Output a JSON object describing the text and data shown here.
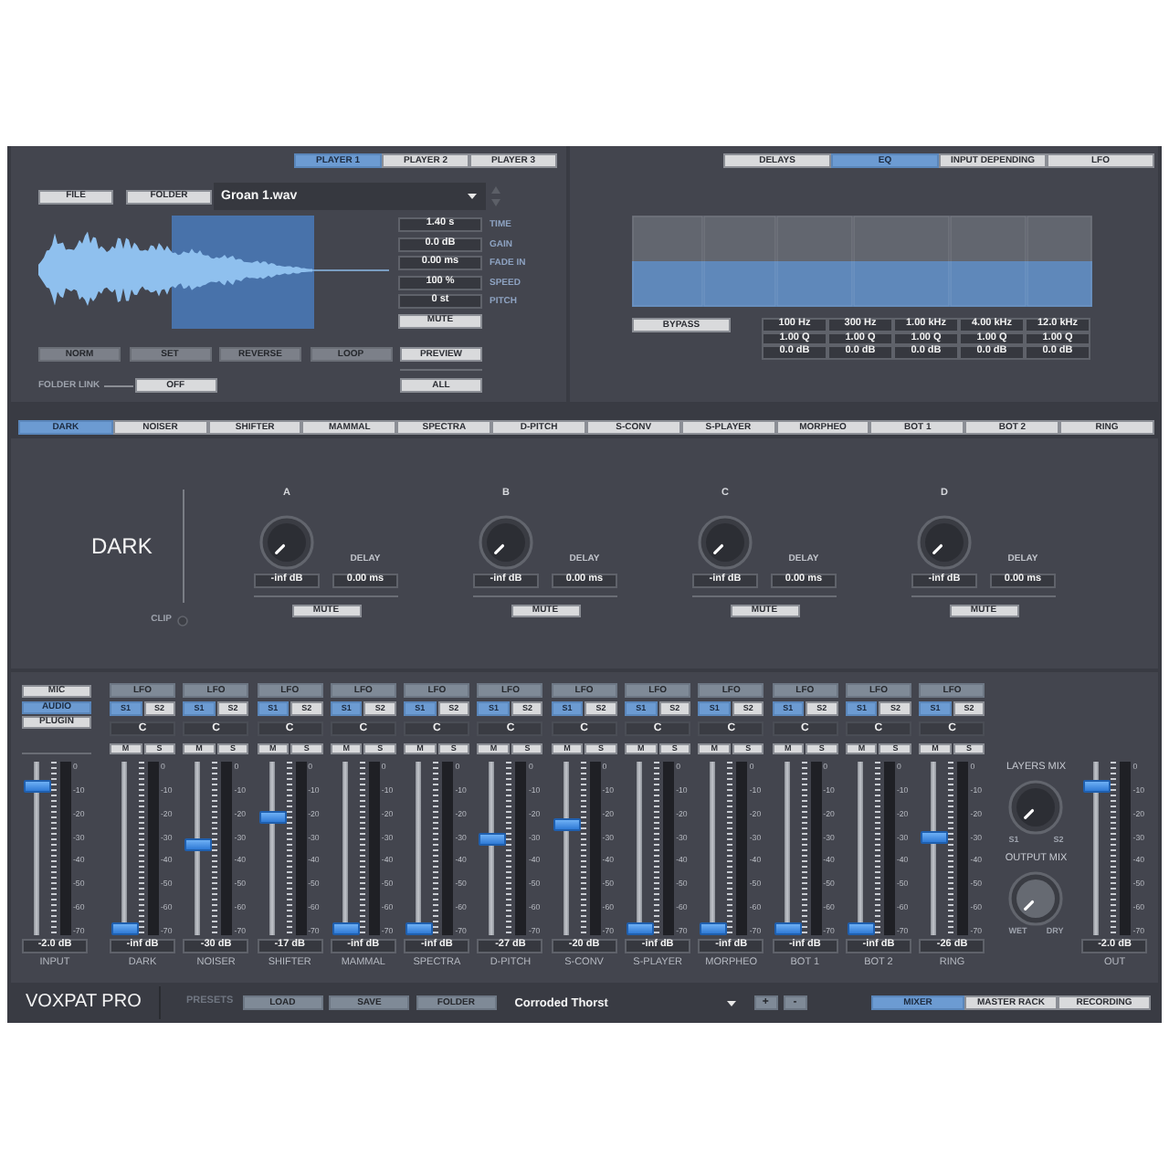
{
  "player": {
    "tabs": [
      {
        "label": "PLAYER 1",
        "selected": true
      },
      {
        "label": "PLAYER 2",
        "selected": false
      },
      {
        "label": "PLAYER 3",
        "selected": false
      }
    ],
    "file_button": "FILE",
    "folder_button": "FOLDER",
    "file_name": "Groan 1.wav",
    "params": [
      {
        "value": "1.40 s",
        "label": "TIME"
      },
      {
        "value": "0.0 dB",
        "label": "GAIN"
      },
      {
        "value": "0.00 ms",
        "label": "FADE IN"
      },
      {
        "value": "100 %",
        "label": "SPEED"
      },
      {
        "value": "0 st",
        "label": "PITCH"
      }
    ],
    "mute_button": "MUTE",
    "edit_buttons": [
      "NORM",
      "SET",
      "REVERSE",
      "LOOP"
    ],
    "preview_button": "PREVIEW",
    "folder_link_label": "FOLDER LINK",
    "folder_link_button": "OFF",
    "all_button": "ALL"
  },
  "eq": {
    "tabs": [
      {
        "label": "DELAYS",
        "selected": false
      },
      {
        "label": "EQ",
        "selected": true
      },
      {
        "label": "INPUT DEPENDING",
        "selected": false
      },
      {
        "label": "LFO",
        "selected": false
      }
    ],
    "bypass_button": "BYPASS",
    "bands": [
      {
        "freq": "100 Hz",
        "q": "1.00 Q",
        "gain": "0.0 dB"
      },
      {
        "freq": "300 Hz",
        "q": "1.00 Q",
        "gain": "0.0 dB"
      },
      {
        "freq": "1.00 kHz",
        "q": "1.00 Q",
        "gain": "0.0 dB"
      },
      {
        "freq": "4.00 kHz",
        "q": "1.00 Q",
        "gain": "0.0 dB"
      },
      {
        "freq": "12.0 kHz",
        "q": "1.00 Q",
        "gain": "0.0 dB"
      }
    ]
  },
  "fx_tabs": [
    {
      "label": "DARK",
      "selected": true
    },
    {
      "label": "NOISER",
      "selected": false
    },
    {
      "label": "SHIFTER",
      "selected": false
    },
    {
      "label": "MAMMAL",
      "selected": false
    },
    {
      "label": "SPECTRA",
      "selected": false
    },
    {
      "label": "D-PITCH",
      "selected": false
    },
    {
      "label": "S-CONV",
      "selected": false
    },
    {
      "label": "S-PLAYER",
      "selected": false
    },
    {
      "label": "MORPHEO",
      "selected": false
    },
    {
      "label": "BOT 1",
      "selected": false
    },
    {
      "label": "BOT 2",
      "selected": false
    },
    {
      "label": "RING",
      "selected": false
    }
  ],
  "fx_panel": {
    "title": "DARK",
    "clip_label": "CLIP",
    "voices": [
      {
        "name": "A",
        "gain": "-inf dB",
        "delay_label": "DELAY",
        "delay": "0.00 ms",
        "mute_button": "MUTE"
      },
      {
        "name": "B",
        "gain": "-inf dB",
        "delay_label": "DELAY",
        "delay": "0.00 ms",
        "mute_button": "MUTE"
      },
      {
        "name": "C",
        "gain": "-inf dB",
        "delay_label": "DELAY",
        "delay": "0.00 ms",
        "mute_button": "MUTE"
      },
      {
        "name": "D",
        "gain": "-inf dB",
        "delay_label": "DELAY",
        "delay": "0.00 ms",
        "mute_button": "MUTE"
      }
    ]
  },
  "mixer": {
    "sources": [
      {
        "label": "MIC",
        "selected": false
      },
      {
        "label": "AUDIO",
        "selected": true
      },
      {
        "label": "PLUGIN",
        "selected": false
      }
    ],
    "input": {
      "name": "INPUT",
      "level": 0.89,
      "value": "-2.0 dB",
      "scale": [
        "0",
        "-10",
        "-20",
        "-30",
        "-40",
        "-50",
        "-60",
        "-70"
      ]
    },
    "channels": [
      {
        "name": "DARK",
        "lfo": "LFO",
        "sends": [
          {
            "label": "S1",
            "selected": true
          },
          {
            "label": "S2",
            "selected": false
          }
        ],
        "pan": "C",
        "mute": "M",
        "solo": "S",
        "level": 0,
        "value": "-inf dB",
        "scale": [
          "0",
          "-10",
          "-20",
          "-30",
          "-40",
          "-50",
          "-60",
          "-70"
        ]
      },
      {
        "name": "NOISER",
        "lfo": "LFO",
        "sends": [
          {
            "label": "S1",
            "selected": true
          },
          {
            "label": "S2",
            "selected": false
          }
        ],
        "pan": "C",
        "mute": "M",
        "solo": "S",
        "level": 0.52,
        "value": "-30 dB",
        "scale": [
          "0",
          "-10",
          "-20",
          "-30",
          "-40",
          "-50",
          "-60",
          "-70"
        ]
      },
      {
        "name": "SHIFTER",
        "lfo": "LFO",
        "sends": [
          {
            "label": "S1",
            "selected": true
          },
          {
            "label": "S2",
            "selected": false
          }
        ],
        "pan": "C",
        "mute": "M",
        "solo": "S",
        "level": 0.69,
        "value": "-17 dB",
        "scale": [
          "0",
          "-10",
          "-20",
          "-30",
          "-40",
          "-50",
          "-60",
          "-70"
        ]
      },
      {
        "name": "MAMMAL",
        "lfo": "LFO",
        "sends": [
          {
            "label": "S1",
            "selected": true
          },
          {
            "label": "S2",
            "selected": false
          }
        ],
        "pan": "C",
        "mute": "M",
        "solo": "S",
        "level": 0,
        "value": "-inf dB",
        "scale": [
          "0",
          "-10",
          "-20",
          "-30",
          "-40",
          "-50",
          "-60",
          "-70"
        ]
      },
      {
        "name": "SPECTRA",
        "lfo": "LFO",
        "sends": [
          {
            "label": "S1",
            "selected": true
          },
          {
            "label": "S2",
            "selected": false
          }
        ],
        "pan": "C",
        "mute": "M",
        "solo": "S",
        "level": 0,
        "value": "-inf dB",
        "scale": [
          "0",
          "-10",
          "-20",
          "-30",
          "-40",
          "-50",
          "-60",
          "-70"
        ]
      },
      {
        "name": "D-PITCH",
        "lfo": "LFO",
        "sends": [
          {
            "label": "S1",
            "selected": true
          },
          {
            "label": "S2",
            "selected": false
          }
        ],
        "pan": "C",
        "mute": "M",
        "solo": "S",
        "level": 0.56,
        "value": "-27 dB",
        "scale": [
          "0",
          "-10",
          "-20",
          "-30",
          "-40",
          "-50",
          "-60",
          "-70"
        ]
      },
      {
        "name": "S-CONV",
        "lfo": "LFO",
        "sends": [
          {
            "label": "S1",
            "selected": true
          },
          {
            "label": "S2",
            "selected": false
          }
        ],
        "pan": "C",
        "mute": "M",
        "solo": "S",
        "level": 0.65,
        "value": "-20 dB",
        "scale": [
          "0",
          "-10",
          "-20",
          "-30",
          "-40",
          "-50",
          "-60",
          "-70"
        ]
      },
      {
        "name": "S-PLAYER",
        "lfo": "LFO",
        "sends": [
          {
            "label": "S1",
            "selected": true
          },
          {
            "label": "S2",
            "selected": false
          }
        ],
        "pan": "C",
        "mute": "M",
        "solo": "S",
        "level": 0,
        "value": "-inf dB",
        "scale": [
          "0",
          "-10",
          "-20",
          "-30",
          "-40",
          "-50",
          "-60",
          "-70"
        ]
      },
      {
        "name": "MORPHEO",
        "lfo": "LFO",
        "sends": [
          {
            "label": "S1",
            "selected": true
          },
          {
            "label": "S2",
            "selected": false
          }
        ],
        "pan": "C",
        "mute": "M",
        "solo": "S",
        "level": 0,
        "value": "-inf dB",
        "scale": [
          "0",
          "-10",
          "-20",
          "-30",
          "-40",
          "-50",
          "-60",
          "-70"
        ]
      },
      {
        "name": "BOT 1",
        "lfo": "LFO",
        "sends": [
          {
            "label": "S1",
            "selected": true
          },
          {
            "label": "S2",
            "selected": false
          }
        ],
        "pan": "C",
        "mute": "M",
        "solo": "S",
        "level": 0,
        "value": "-inf dB",
        "scale": [
          "0",
          "-10",
          "-20",
          "-30",
          "-40",
          "-50",
          "-60",
          "-70"
        ]
      },
      {
        "name": "BOT 2",
        "lfo": "LFO",
        "sends": [
          {
            "label": "S1",
            "selected": true
          },
          {
            "label": "S2",
            "selected": false
          }
        ],
        "pan": "C",
        "mute": "M",
        "solo": "S",
        "level": 0,
        "value": "-inf dB",
        "scale": [
          "0",
          "-10",
          "-20",
          "-30",
          "-40",
          "-50",
          "-60",
          "-70"
        ]
      },
      {
        "name": "RING",
        "lfo": "LFO",
        "sends": [
          {
            "label": "S1",
            "selected": true
          },
          {
            "label": "S2",
            "selected": false
          }
        ],
        "pan": "C",
        "mute": "M",
        "solo": "S",
        "level": 0.57,
        "value": "-26 dB",
        "scale": [
          "0",
          "-10",
          "-20",
          "-30",
          "-40",
          "-50",
          "-60",
          "-70"
        ]
      }
    ],
    "layers_mix": {
      "label": "LAYERS MIX",
      "left": "S1",
      "right": "S2"
    },
    "output_mix": {
      "label": "OUTPUT MIX",
      "left": "WET",
      "right": "DRY"
    },
    "output": {
      "name": "OUT",
      "level": 0.89,
      "value": "-2.0 dB",
      "scale": [
        "0",
        "-10",
        "-20",
        "-30",
        "-40",
        "-50",
        "-60",
        "-70"
      ]
    }
  },
  "bottom_bar": {
    "product": "VOXPAT PRO",
    "presets_label": "PRESETS",
    "buttons": [
      "LOAD",
      "SAVE",
      "FOLDER"
    ],
    "preset_name": "Corroded Thorst",
    "step_buttons": [
      "+",
      "-"
    ],
    "views": [
      {
        "label": "MIXER",
        "selected": true
      },
      {
        "label": "MASTER RACK",
        "selected": false
      },
      {
        "label": "RECORDING",
        "selected": false
      }
    ]
  }
}
